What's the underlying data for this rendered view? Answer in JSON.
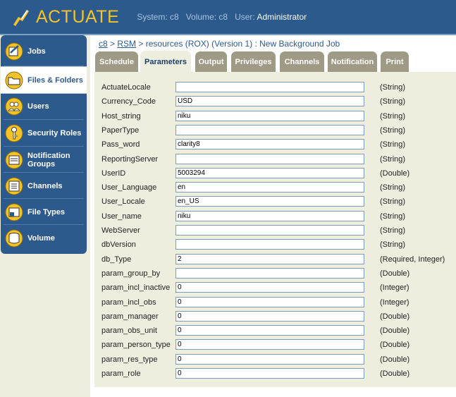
{
  "app": {
    "logo_text": "ACTUATE",
    "system_label": "System:",
    "system_value": "c8",
    "volume_label": "Volume:",
    "volume_value": "c8",
    "user_label": "User:",
    "user_value": "Administrator"
  },
  "colors": {
    "header_blue": "#2c5a8d",
    "logo_yellow": "#f4c32a",
    "tab_inactive": "#9e9a86",
    "panel_beige": "#eeeedf"
  },
  "sidebar": {
    "items": [
      {
        "label": "Jobs",
        "icon": "jobs-icon",
        "active": false
      },
      {
        "label": "Files & Folders",
        "icon": "folder-icon",
        "active": true
      },
      {
        "label": "Users",
        "icon": "users-icon",
        "active": false
      },
      {
        "label": "Security Roles",
        "icon": "key-icon",
        "active": false
      },
      {
        "label": "Notification Groups",
        "icon": "notification-icon",
        "active": false
      },
      {
        "label": "Channels",
        "icon": "channels-icon",
        "active": false
      },
      {
        "label": "File Types",
        "icon": "file-types-icon",
        "active": false
      },
      {
        "label": "Volume",
        "icon": "volume-icon",
        "active": false
      }
    ]
  },
  "breadcrumb": {
    "c8": "c8",
    "sep1": ">",
    "rsm": "RSM",
    "rest": "> resources  (ROX) (Version 1) : New Background Job"
  },
  "tabs": [
    {
      "label": "Schedule",
      "active": false
    },
    {
      "label": "Parameters",
      "active": true
    },
    {
      "label": "Output",
      "active": false
    },
    {
      "label": "Privileges",
      "active": false
    },
    {
      "label": "Channels",
      "active": false
    },
    {
      "label": "Notification",
      "active": false
    },
    {
      "label": "Print",
      "active": false
    }
  ],
  "parameters": [
    {
      "name": "ActuateLocale",
      "value": "",
      "type": "(String)"
    },
    {
      "name": "Currency_Code",
      "value": "USD",
      "type": "(String)"
    },
    {
      "name": "Host_string",
      "value": "niku",
      "type": "(String)"
    },
    {
      "name": "PaperType",
      "value": "",
      "type": "(String)"
    },
    {
      "name": "Pass_word",
      "value": "clarity8",
      "type": "(String)"
    },
    {
      "name": "ReportingServer",
      "value": "",
      "type": "(String)"
    },
    {
      "name": "UserID",
      "value": "5003294",
      "type": "(Double)"
    },
    {
      "name": "User_Language",
      "value": "en",
      "type": "(String)"
    },
    {
      "name": "User_Locale",
      "value": "en_US",
      "type": "(String)"
    },
    {
      "name": "User_name",
      "value": "niku",
      "type": "(String)"
    },
    {
      "name": "WebServer",
      "value": "",
      "type": "(String)"
    },
    {
      "name": "dbVersion",
      "value": "",
      "type": "(String)"
    },
    {
      "name": "db_Type",
      "value": "2",
      "type": "(Required, Integer)"
    },
    {
      "name": "param_group_by",
      "value": "",
      "type": "(Double)"
    },
    {
      "name": "param_incl_inactive",
      "value": "0",
      "type": "(Integer)"
    },
    {
      "name": "param_incl_obs",
      "value": "0",
      "type": "(Integer)"
    },
    {
      "name": "param_manager",
      "value": "0",
      "type": "(Double)"
    },
    {
      "name": "param_obs_unit",
      "value": "0",
      "type": "(Double)"
    },
    {
      "name": "param_person_type",
      "value": "0",
      "type": "(Double)"
    },
    {
      "name": "param_res_type",
      "value": "0",
      "type": "(Double)"
    },
    {
      "name": "param_role",
      "value": "0",
      "type": "(Double)"
    }
  ]
}
